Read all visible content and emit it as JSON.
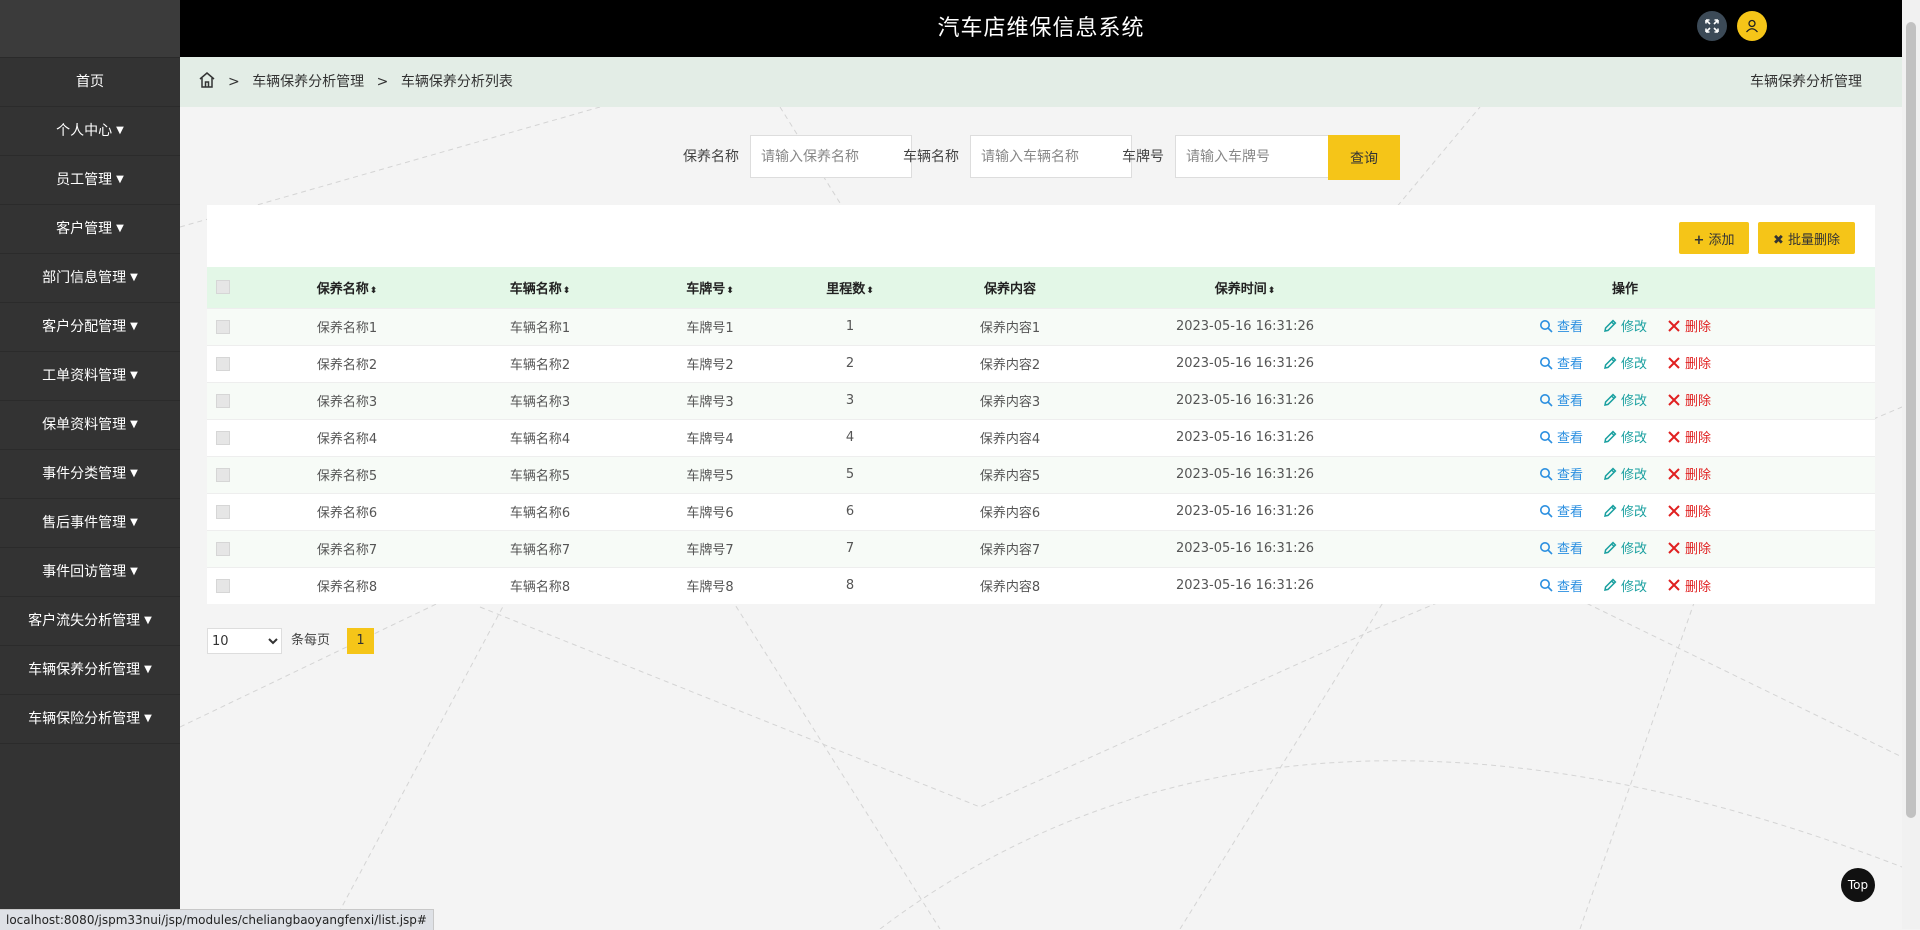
{
  "app": {
    "title": "汽车店维保信息系统"
  },
  "sidebar": {
    "items": [
      {
        "label": "首页",
        "has_caret": false
      },
      {
        "label": "个人中心",
        "has_caret": true
      },
      {
        "label": "员工管理",
        "has_caret": true
      },
      {
        "label": "客户管理",
        "has_caret": true
      },
      {
        "label": "部门信息管理",
        "has_caret": true
      },
      {
        "label": "客户分配管理",
        "has_caret": true
      },
      {
        "label": "工单资料管理",
        "has_caret": true
      },
      {
        "label": "保单资料管理",
        "has_caret": true
      },
      {
        "label": "事件分类管理",
        "has_caret": true
      },
      {
        "label": "售后事件管理",
        "has_caret": true
      },
      {
        "label": "事件回访管理",
        "has_caret": true
      },
      {
        "label": "客户流失分析管理",
        "has_caret": true
      },
      {
        "label": "车辆保养分析管理",
        "has_caret": true
      },
      {
        "label": "车辆保险分析管理",
        "has_caret": true
      }
    ]
  },
  "breadcrumb": {
    "separator": ">",
    "items": [
      "车辆保养分析管理",
      "车辆保养分析列表"
    ],
    "right_title": "车辆保养分析管理"
  },
  "search": {
    "fields": [
      {
        "label": "保养名称",
        "placeholder": "请输入保养名称",
        "value": ""
      },
      {
        "label": "车辆名称",
        "placeholder": "请输入车辆名称",
        "value": ""
      },
      {
        "label": "车牌号",
        "placeholder": "请输入车牌号",
        "value": ""
      }
    ],
    "query_label": "查询"
  },
  "actions": {
    "add_label": "添加",
    "batch_delete_label": "批量删除"
  },
  "table": {
    "columns": [
      {
        "label": "保养名称",
        "sortable": true
      },
      {
        "label": "车辆名称",
        "sortable": true
      },
      {
        "label": "车牌号",
        "sortable": true
      },
      {
        "label": "里程数",
        "sortable": true
      },
      {
        "label": "保养内容",
        "sortable": false
      },
      {
        "label": "保养时间",
        "sortable": true
      },
      {
        "label": "操作",
        "sortable": false
      }
    ],
    "op_labels": {
      "view": "查看",
      "edit": "修改",
      "delete": "删除"
    },
    "rows": [
      {
        "name": "保养名称1",
        "vehicle": "车辆名称1",
        "plate": "车牌号1",
        "mileage": "1",
        "content": "保养内容1",
        "time": "2023-05-16 16:31:26"
      },
      {
        "name": "保养名称2",
        "vehicle": "车辆名称2",
        "plate": "车牌号2",
        "mileage": "2",
        "content": "保养内容2",
        "time": "2023-05-16 16:31:26"
      },
      {
        "name": "保养名称3",
        "vehicle": "车辆名称3",
        "plate": "车牌号3",
        "mileage": "3",
        "content": "保养内容3",
        "time": "2023-05-16 16:31:26"
      },
      {
        "name": "保养名称4",
        "vehicle": "车辆名称4",
        "plate": "车牌号4",
        "mileage": "4",
        "content": "保养内容4",
        "time": "2023-05-16 16:31:26"
      },
      {
        "name": "保养名称5",
        "vehicle": "车辆名称5",
        "plate": "车牌号5",
        "mileage": "5",
        "content": "保养内容5",
        "time": "2023-05-16 16:31:26"
      },
      {
        "name": "保养名称6",
        "vehicle": "车辆名称6",
        "plate": "车牌号6",
        "mileage": "6",
        "content": "保养内容6",
        "time": "2023-05-16 16:31:26"
      },
      {
        "name": "保养名称7",
        "vehicle": "车辆名称7",
        "plate": "车牌号7",
        "mileage": "7",
        "content": "保养内容7",
        "time": "2023-05-16 16:31:26"
      },
      {
        "name": "保养名称8",
        "vehicle": "车辆名称8",
        "plate": "车牌号8",
        "mileage": "8",
        "content": "保养内容8",
        "time": "2023-05-16 16:31:26"
      }
    ]
  },
  "pagination": {
    "page_size_options": [
      "10"
    ],
    "page_size": "10",
    "per_page_label": "条每页",
    "current_page": "1"
  },
  "top_button_label": "Top",
  "status_url": "localhost:8080/jspm33nui/jsp/modules/cheliangbaoyangfenxi/list.jsp#",
  "colors": {
    "sidebar_bg": "#333333",
    "header_bg": "#000000",
    "accent_yellow": "#f5c518",
    "table_header_bg": "#e3f7e7",
    "breadcrumb_bg": "#e3ede6",
    "view_link": "#2b8fe0",
    "edit_link": "#1aa0a0",
    "delete_link": "#e02020"
  },
  "icons": {
    "fullscreen": "expand-arrows-icon",
    "user": "user-icon",
    "home": "home-icon",
    "add": "plus-icon",
    "batch_delete": "x-icon",
    "view": "search-icon",
    "edit": "pencil-icon",
    "delete": "close-icon",
    "sort": "sort-icon"
  }
}
